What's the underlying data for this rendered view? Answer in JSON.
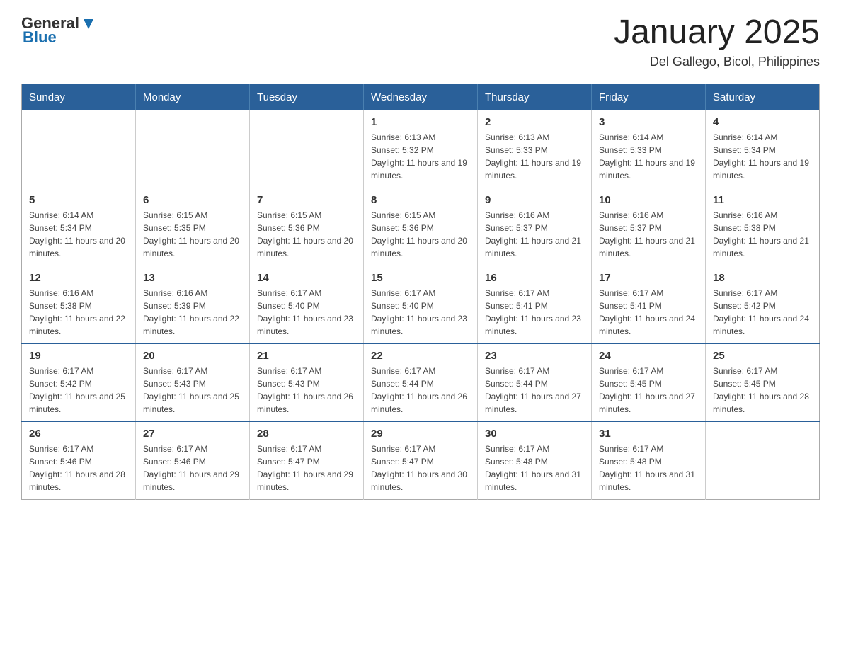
{
  "header": {
    "logo": {
      "general": "General",
      "blue": "Blue"
    },
    "title": "January 2025",
    "subtitle": "Del Gallego, Bicol, Philippines"
  },
  "days_of_week": [
    "Sunday",
    "Monday",
    "Tuesday",
    "Wednesday",
    "Thursday",
    "Friday",
    "Saturday"
  ],
  "weeks": [
    [
      {
        "day": "",
        "info": ""
      },
      {
        "day": "",
        "info": ""
      },
      {
        "day": "",
        "info": ""
      },
      {
        "day": "1",
        "info": "Sunrise: 6:13 AM\nSunset: 5:32 PM\nDaylight: 11 hours and 19 minutes."
      },
      {
        "day": "2",
        "info": "Sunrise: 6:13 AM\nSunset: 5:33 PM\nDaylight: 11 hours and 19 minutes."
      },
      {
        "day": "3",
        "info": "Sunrise: 6:14 AM\nSunset: 5:33 PM\nDaylight: 11 hours and 19 minutes."
      },
      {
        "day": "4",
        "info": "Sunrise: 6:14 AM\nSunset: 5:34 PM\nDaylight: 11 hours and 19 minutes."
      }
    ],
    [
      {
        "day": "5",
        "info": "Sunrise: 6:14 AM\nSunset: 5:34 PM\nDaylight: 11 hours and 20 minutes."
      },
      {
        "day": "6",
        "info": "Sunrise: 6:15 AM\nSunset: 5:35 PM\nDaylight: 11 hours and 20 minutes."
      },
      {
        "day": "7",
        "info": "Sunrise: 6:15 AM\nSunset: 5:36 PM\nDaylight: 11 hours and 20 minutes."
      },
      {
        "day": "8",
        "info": "Sunrise: 6:15 AM\nSunset: 5:36 PM\nDaylight: 11 hours and 20 minutes."
      },
      {
        "day": "9",
        "info": "Sunrise: 6:16 AM\nSunset: 5:37 PM\nDaylight: 11 hours and 21 minutes."
      },
      {
        "day": "10",
        "info": "Sunrise: 6:16 AM\nSunset: 5:37 PM\nDaylight: 11 hours and 21 minutes."
      },
      {
        "day": "11",
        "info": "Sunrise: 6:16 AM\nSunset: 5:38 PM\nDaylight: 11 hours and 21 minutes."
      }
    ],
    [
      {
        "day": "12",
        "info": "Sunrise: 6:16 AM\nSunset: 5:38 PM\nDaylight: 11 hours and 22 minutes."
      },
      {
        "day": "13",
        "info": "Sunrise: 6:16 AM\nSunset: 5:39 PM\nDaylight: 11 hours and 22 minutes."
      },
      {
        "day": "14",
        "info": "Sunrise: 6:17 AM\nSunset: 5:40 PM\nDaylight: 11 hours and 23 minutes."
      },
      {
        "day": "15",
        "info": "Sunrise: 6:17 AM\nSunset: 5:40 PM\nDaylight: 11 hours and 23 minutes."
      },
      {
        "day": "16",
        "info": "Sunrise: 6:17 AM\nSunset: 5:41 PM\nDaylight: 11 hours and 23 minutes."
      },
      {
        "day": "17",
        "info": "Sunrise: 6:17 AM\nSunset: 5:41 PM\nDaylight: 11 hours and 24 minutes."
      },
      {
        "day": "18",
        "info": "Sunrise: 6:17 AM\nSunset: 5:42 PM\nDaylight: 11 hours and 24 minutes."
      }
    ],
    [
      {
        "day": "19",
        "info": "Sunrise: 6:17 AM\nSunset: 5:42 PM\nDaylight: 11 hours and 25 minutes."
      },
      {
        "day": "20",
        "info": "Sunrise: 6:17 AM\nSunset: 5:43 PM\nDaylight: 11 hours and 25 minutes."
      },
      {
        "day": "21",
        "info": "Sunrise: 6:17 AM\nSunset: 5:43 PM\nDaylight: 11 hours and 26 minutes."
      },
      {
        "day": "22",
        "info": "Sunrise: 6:17 AM\nSunset: 5:44 PM\nDaylight: 11 hours and 26 minutes."
      },
      {
        "day": "23",
        "info": "Sunrise: 6:17 AM\nSunset: 5:44 PM\nDaylight: 11 hours and 27 minutes."
      },
      {
        "day": "24",
        "info": "Sunrise: 6:17 AM\nSunset: 5:45 PM\nDaylight: 11 hours and 27 minutes."
      },
      {
        "day": "25",
        "info": "Sunrise: 6:17 AM\nSunset: 5:45 PM\nDaylight: 11 hours and 28 minutes."
      }
    ],
    [
      {
        "day": "26",
        "info": "Sunrise: 6:17 AM\nSunset: 5:46 PM\nDaylight: 11 hours and 28 minutes."
      },
      {
        "day": "27",
        "info": "Sunrise: 6:17 AM\nSunset: 5:46 PM\nDaylight: 11 hours and 29 minutes."
      },
      {
        "day": "28",
        "info": "Sunrise: 6:17 AM\nSunset: 5:47 PM\nDaylight: 11 hours and 29 minutes."
      },
      {
        "day": "29",
        "info": "Sunrise: 6:17 AM\nSunset: 5:47 PM\nDaylight: 11 hours and 30 minutes."
      },
      {
        "day": "30",
        "info": "Sunrise: 6:17 AM\nSunset: 5:48 PM\nDaylight: 11 hours and 31 minutes."
      },
      {
        "day": "31",
        "info": "Sunrise: 6:17 AM\nSunset: 5:48 PM\nDaylight: 11 hours and 31 minutes."
      },
      {
        "day": "",
        "info": ""
      }
    ]
  ]
}
